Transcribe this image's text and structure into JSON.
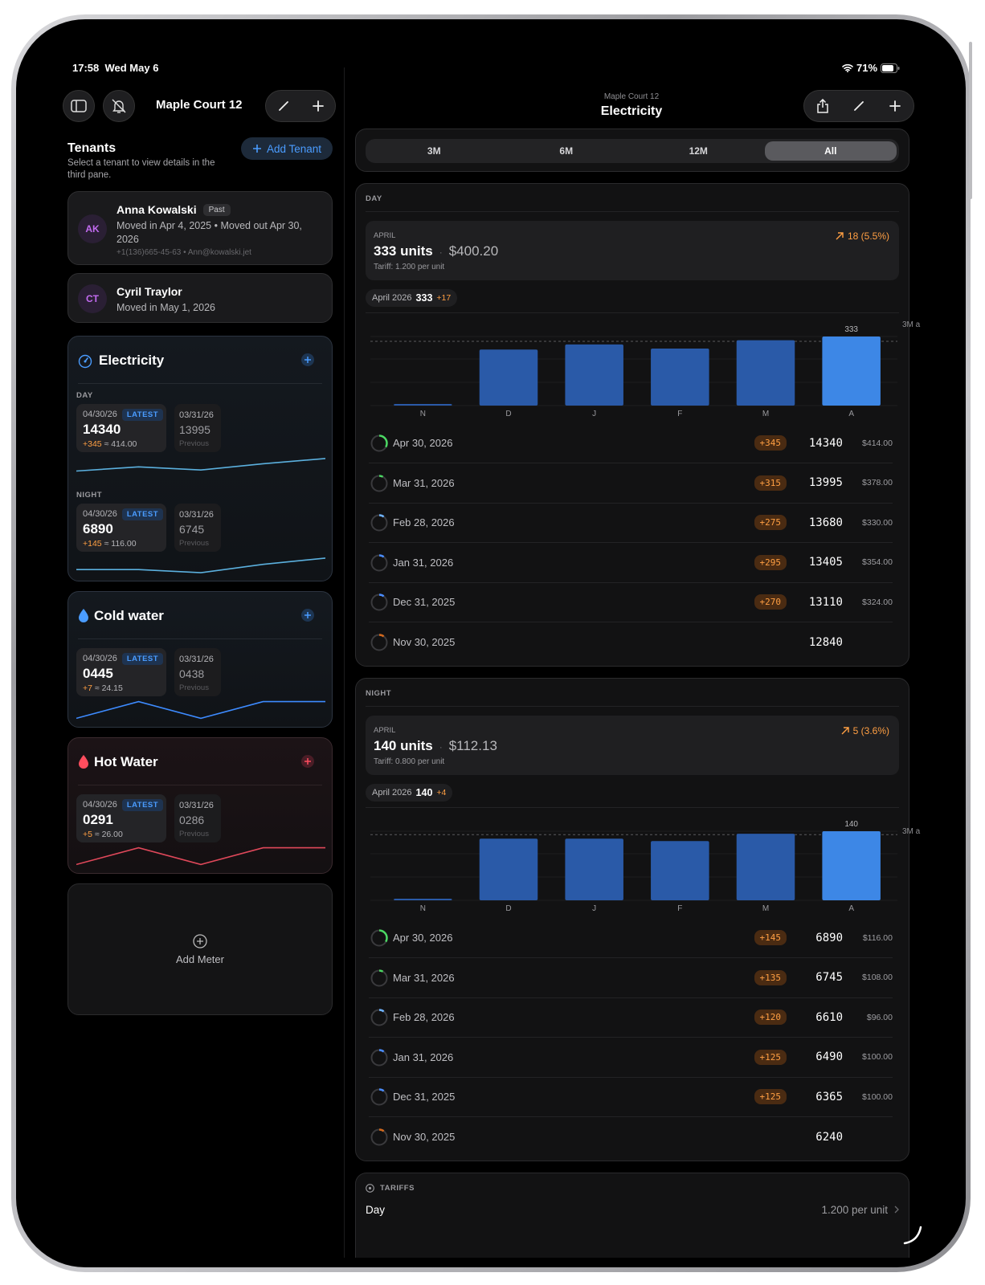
{
  "status": {
    "time": "17:58",
    "date": "Wed May 6",
    "battery": "71%"
  },
  "left": {
    "property_title": "Maple Court 12",
    "tenants_title": "Tenants",
    "tenants_hint": "Select a tenant to view details in the third pane.",
    "add_tenant": "Add Tenant",
    "tenants": [
      {
        "initials": "AK",
        "name": "Anna Kowalski",
        "badge": "Past",
        "dates": "Moved in Apr 4, 2025 • Moved out Apr 30, 2026",
        "contact": "+1(136)665-45-63 • Ann@kowalski.jet"
      },
      {
        "initials": "CT",
        "name": "Cyril Traylor",
        "dates": "Moved in May 1, 2026"
      }
    ],
    "meters": [
      {
        "title": "Electricity",
        "icon": "gauge-icon",
        "accent": "#4a9cff",
        "sections": [
          {
            "label": "DAY",
            "latest_date": "04/30/26",
            "latest_tag": "LATEST",
            "latest_value": "14340",
            "delta": "+345",
            "approx": "≈ 414.00",
            "prev_date": "03/31/26",
            "prev_value": "13995",
            "prev_label": "Previous",
            "spark": [
              0.25,
              0.45,
              0.3,
              0.6,
              0.85
            ]
          },
          {
            "label": "NIGHT",
            "latest_date": "04/30/26",
            "latest_tag": "LATEST",
            "latest_value": "6890",
            "delta": "+145",
            "approx": "≈ 116.00",
            "prev_date": "03/31/26",
            "prev_value": "6745",
            "prev_label": "Previous",
            "spark": [
              0.3,
              0.3,
              0.15,
              0.55,
              0.85
            ]
          }
        ]
      },
      {
        "title": "Cold water",
        "icon": "droplet-icon",
        "accent": "#4a9cff",
        "sections": [
          {
            "label": "",
            "latest_date": "04/30/26",
            "latest_tag": "LATEST",
            "latest_value": "0445",
            "delta": "+7",
            "approx": "≈ 24.15",
            "prev_date": "03/31/26",
            "prev_value": "0438",
            "prev_label": "Previous",
            "spark": [
              0.1,
              0.9,
              0.1,
              0.9,
              0.9
            ]
          }
        ]
      },
      {
        "title": "Hot Water",
        "icon": "droplet-icon",
        "accent": "#ff4d5e",
        "sections": [
          {
            "label": "",
            "latest_date": "04/30/26",
            "latest_tag": "LATEST",
            "latest_value": "0291",
            "delta": "+5",
            "approx": "≈ 26.00",
            "prev_date": "03/31/26",
            "prev_value": "0286",
            "prev_label": "Previous",
            "spark": [
              0.1,
              0.9,
              0.1,
              0.9,
              0.9
            ]
          }
        ]
      }
    ],
    "add_meter": "Add Meter"
  },
  "right": {
    "subtitle": "Maple Court 12",
    "title": "Electricity",
    "ranges": [
      "3M",
      "6M",
      "12M",
      "All"
    ],
    "selected_range": "All",
    "panels": [
      {
        "label": "DAY",
        "month": "APRIL",
        "units": "333 units",
        "cost": "$400.20",
        "tariff": "Tariff: 1.200 per unit",
        "trend": "18 (5.5%)",
        "badge_period": "April 2026",
        "badge_value": "333",
        "badge_delta": "+17",
        "avg_label": "3M a",
        "chart_data": {
          "type": "bar",
          "categories": [
            "N",
            "D",
            "J",
            "F",
            "M",
            "A"
          ],
          "values": [
            2,
            270,
            295,
            275,
            315,
            333
          ],
          "max": 333,
          "highlight_label": "333",
          "reference": 310
        },
        "history": [
          {
            "date": "Apr 30, 2026",
            "delta": "+345",
            "value": "14340",
            "money": "$414.00",
            "color": "#4cd964",
            "frac": 0.33
          },
          {
            "date": "Mar 31, 2026",
            "delta": "+315",
            "value": "13995",
            "money": "$378.00",
            "color": "#4cd964",
            "frac": 0.08
          },
          {
            "date": "Feb 28, 2026",
            "delta": "+275",
            "value": "13680",
            "money": "$330.00",
            "color": "#6fb3ff",
            "frac": 0.1
          },
          {
            "date": "Jan 31, 2026",
            "delta": "+295",
            "value": "13405",
            "money": "$354.00",
            "color": "#4a8cff",
            "frac": 0.1
          },
          {
            "date": "Dec 31, 2025",
            "delta": "+270",
            "value": "13110",
            "money": "$324.00",
            "color": "#4a8cff",
            "frac": 0.1
          },
          {
            "date": "Nov 30, 2025",
            "delta": "",
            "value": "12840",
            "money": "",
            "color": "#d2691e",
            "frac": 0.1
          }
        ]
      },
      {
        "label": "NIGHT",
        "month": "APRIL",
        "units": "140 units",
        "cost": "$112.13",
        "tariff": "Tariff: 0.800 per unit",
        "trend": "5 (3.6%)",
        "badge_period": "April 2026",
        "badge_value": "140",
        "badge_delta": "+4",
        "avg_label": "3M a",
        "chart_data": {
          "type": "bar",
          "categories": [
            "N",
            "D",
            "J",
            "F",
            "M",
            "A"
          ],
          "values": [
            2,
            125,
            125,
            120,
            135,
            140
          ],
          "max": 140,
          "highlight_label": "140",
          "reference": 133
        },
        "history": [
          {
            "date": "Apr 30, 2026",
            "delta": "+145",
            "value": "6890",
            "money": "$116.00",
            "color": "#4cd964",
            "frac": 0.33
          },
          {
            "date": "Mar 31, 2026",
            "delta": "+135",
            "value": "6745",
            "money": "$108.00",
            "color": "#4cd964",
            "frac": 0.08
          },
          {
            "date": "Feb 28, 2026",
            "delta": "+120",
            "value": "6610",
            "money": "$96.00",
            "color": "#6fb3ff",
            "frac": 0.1
          },
          {
            "date": "Jan 31, 2026",
            "delta": "+125",
            "value": "6490",
            "money": "$100.00",
            "color": "#4a8cff",
            "frac": 0.1
          },
          {
            "date": "Dec 31, 2025",
            "delta": "+125",
            "value": "6365",
            "money": "$100.00",
            "color": "#4a8cff",
            "frac": 0.1
          },
          {
            "date": "Nov 30, 2025",
            "delta": "",
            "value": "6240",
            "money": "",
            "color": "#d2691e",
            "frac": 0.1
          }
        ]
      }
    ],
    "tariffs_label": "TARIFFS",
    "tariff_rows": [
      {
        "name": "Day",
        "value": "1.200 per unit"
      }
    ]
  }
}
